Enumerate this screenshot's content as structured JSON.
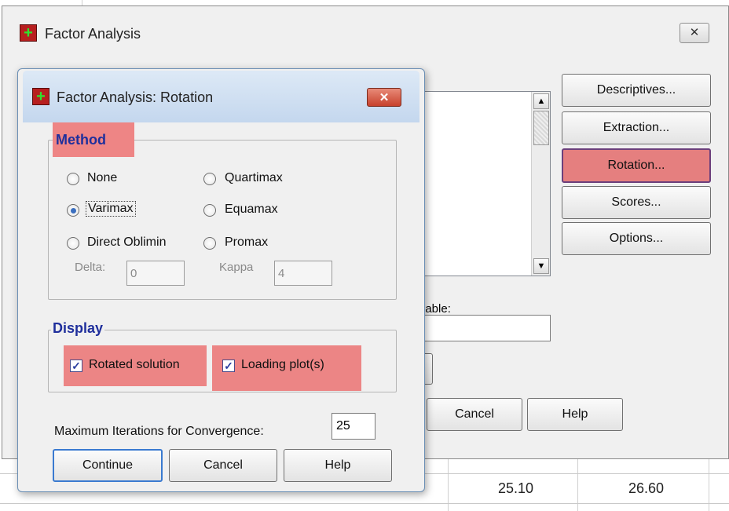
{
  "sheet": {
    "cells": [
      "25.10",
      "26.60"
    ]
  },
  "main_dialog": {
    "title": "Factor Analysis",
    "close_label": "✕",
    "buttons": {
      "descriptives": "Descriptives...",
      "extraction": "Extraction...",
      "rotation": "Rotation...",
      "scores": "Scores...",
      "options": "Options..."
    },
    "variable_label": "iable:",
    "cancel_label": "Cancel",
    "help_label": "Help"
  },
  "rotation_dialog": {
    "title": "Factor Analysis: Rotation",
    "close_label": "✕",
    "method": {
      "legend": "Method",
      "options": {
        "none": "None",
        "quartimax": "Quartimax",
        "varimax": "Varimax",
        "equamax": "Equamax",
        "direct_oblimin": "Direct Oblimin",
        "promax": "Promax"
      },
      "selected": "Varimax",
      "delta_label": "Delta:",
      "delta_value": "0",
      "kappa_label": "Kappa",
      "kappa_value": "4"
    },
    "display": {
      "legend": "Display",
      "rotated_solution": "Rotated solution",
      "loading_plots": "Loading plot(s)",
      "rotated_solution_checked": true,
      "loading_plots_checked": true
    },
    "max_iterations_label": "Maximum Iterations for Convergence:",
    "max_iterations_value": "25",
    "continue_label": "Continue",
    "cancel_label": "Cancel",
    "help_label": "Help"
  },
  "colors": {
    "highlight": "#ec8585",
    "legend_text": "#1f2f9c"
  }
}
